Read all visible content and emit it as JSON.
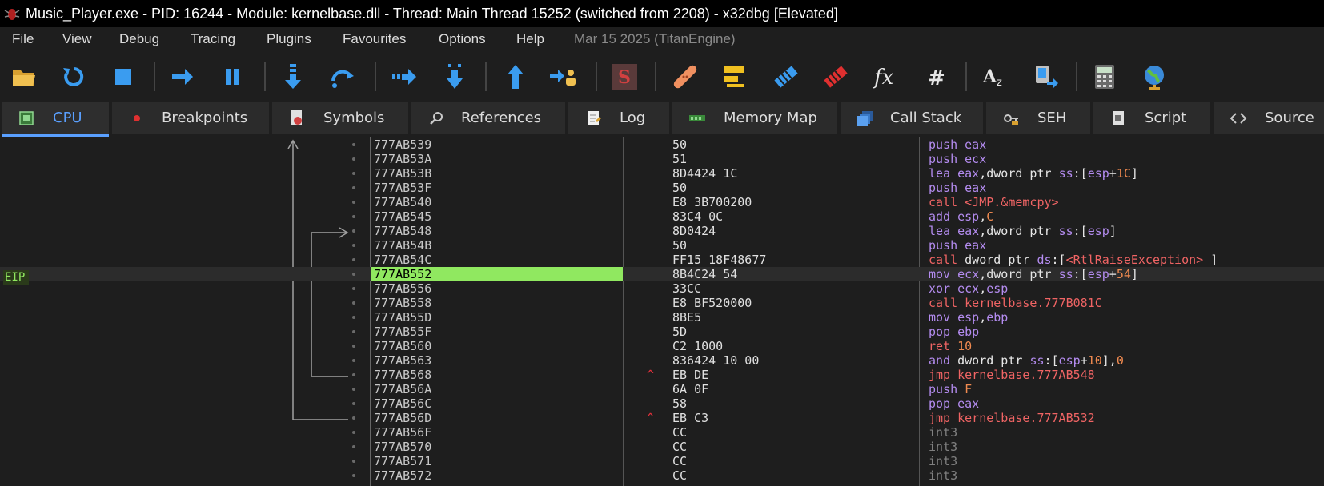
{
  "window": {
    "title": "Music_Player.exe - PID: 16244 - Module: kernelbase.dll - Thread: Main Thread 15252 (switched from 2208) - x32dbg [Elevated]"
  },
  "menu": {
    "items": [
      "File",
      "View",
      "Debug",
      "Tracing",
      "Plugins",
      "Favourites",
      "Options",
      "Help"
    ],
    "date": "Mar 15 2025 (TitanEngine)"
  },
  "toolbar": {
    "buttons": [
      "open-icon",
      "restart-icon",
      "stop-icon",
      "run-icon",
      "pause-icon",
      "step-into-icon",
      "step-over-icon",
      "trace-into-icon",
      "trace-over-icon",
      "execute-till-return-icon",
      "run-to-user-code-icon",
      "scylla-icon",
      "patch-icon",
      "comment-icon",
      "label-icon",
      "bookmark-icon",
      "function-icon",
      "hash-icon",
      "font-icon",
      "device-icon",
      "calculator-icon",
      "globe-icon"
    ]
  },
  "tabs": [
    {
      "label": "CPU",
      "icon": "cpu-icon",
      "active": true
    },
    {
      "label": "Breakpoints",
      "icon": "breakpoint-icon"
    },
    {
      "label": "Symbols",
      "icon": "symbols-icon"
    },
    {
      "label": "References",
      "icon": "references-icon"
    },
    {
      "label": "Log",
      "icon": "log-icon"
    },
    {
      "label": "Memory Map",
      "icon": "memory-map-icon"
    },
    {
      "label": "Call Stack",
      "icon": "call-stack-icon"
    },
    {
      "label": "SEH",
      "icon": "seh-icon"
    },
    {
      "label": "Script",
      "icon": "script-icon"
    },
    {
      "label": "Source",
      "icon": "source-icon"
    }
  ],
  "eip_label": "EIP",
  "disasm": [
    {
      "addr": "777AB539",
      "bytes": "50",
      "marker": "",
      "ins": [
        [
          "push ",
          "purple"
        ],
        [
          "eax",
          "purple"
        ]
      ]
    },
    {
      "addr": "777AB53A",
      "bytes": "51",
      "marker": "",
      "ins": [
        [
          "push ",
          "purple"
        ],
        [
          "ecx",
          "purple"
        ]
      ]
    },
    {
      "addr": "777AB53B",
      "bytes": "8D4424 1C",
      "marker": "",
      "ins": [
        [
          "lea ",
          "purple"
        ],
        [
          "eax",
          "purple"
        ],
        [
          ",dword ptr ",
          "white"
        ],
        [
          "ss",
          "purple"
        ],
        [
          ":[",
          "white"
        ],
        [
          "esp",
          "purple"
        ],
        [
          "+",
          "white"
        ],
        [
          "1C",
          "orange"
        ],
        [
          "]",
          "white"
        ]
      ]
    },
    {
      "addr": "777AB53F",
      "bytes": "50",
      "marker": "",
      "ins": [
        [
          "push ",
          "purple"
        ],
        [
          "eax",
          "purple"
        ]
      ]
    },
    {
      "addr": "777AB540",
      "bytes": "E8 3B700200",
      "marker": "",
      "ins": [
        [
          "call ",
          "red"
        ],
        [
          "<JMP.&memcpy>",
          "red"
        ]
      ]
    },
    {
      "addr": "777AB545",
      "bytes": "83C4 0C",
      "marker": "",
      "ins": [
        [
          "add ",
          "purple"
        ],
        [
          "esp",
          "purple"
        ],
        [
          ",",
          "white"
        ],
        [
          "C",
          "orange"
        ]
      ]
    },
    {
      "addr": "777AB548",
      "bytes": "8D0424",
      "marker": "",
      "ins": [
        [
          "lea ",
          "purple"
        ],
        [
          "eax",
          "purple"
        ],
        [
          ",dword ptr ",
          "white"
        ],
        [
          "ss",
          "purple"
        ],
        [
          ":[",
          "white"
        ],
        [
          "esp",
          "purple"
        ],
        [
          "]",
          "white"
        ]
      ]
    },
    {
      "addr": "777AB54B",
      "bytes": "50",
      "marker": "",
      "ins": [
        [
          "push ",
          "purple"
        ],
        [
          "eax",
          "purple"
        ]
      ]
    },
    {
      "addr": "777AB54C",
      "bytes": "FF15 18F48677",
      "marker": "",
      "ins": [
        [
          "call ",
          "red"
        ],
        [
          "dword ptr ",
          "white"
        ],
        [
          "ds",
          "purple"
        ],
        [
          ":[",
          "white"
        ],
        [
          "<RtlRaiseException>",
          "red"
        ],
        [
          " ]",
          "white"
        ]
      ]
    },
    {
      "addr": "777AB552",
      "bytes": "8B4C24 54",
      "marker": "",
      "eip": true,
      "ins": [
        [
          "mov ",
          "purple"
        ],
        [
          "ecx",
          "purple"
        ],
        [
          ",dword ptr ",
          "white"
        ],
        [
          "ss",
          "purple"
        ],
        [
          ":[",
          "white"
        ],
        [
          "esp",
          "purple"
        ],
        [
          "+",
          "white"
        ],
        [
          "54",
          "orange"
        ],
        [
          "]",
          "white"
        ]
      ]
    },
    {
      "addr": "777AB556",
      "bytes": "33CC",
      "marker": "",
      "ins": [
        [
          "xor ",
          "purple"
        ],
        [
          "ecx",
          "purple"
        ],
        [
          ",",
          "white"
        ],
        [
          "esp",
          "purple"
        ]
      ]
    },
    {
      "addr": "777AB558",
      "bytes": "E8 BF520000",
      "marker": "",
      "ins": [
        [
          "call ",
          "red"
        ],
        [
          "kernelbase.777B081C",
          "red"
        ]
      ]
    },
    {
      "addr": "777AB55D",
      "bytes": "8BE5",
      "marker": "",
      "ins": [
        [
          "mov ",
          "purple"
        ],
        [
          "esp",
          "purple"
        ],
        [
          ",",
          "white"
        ],
        [
          "ebp",
          "purple"
        ]
      ]
    },
    {
      "addr": "777AB55F",
      "bytes": "5D",
      "marker": "",
      "ins": [
        [
          "pop ",
          "purple"
        ],
        [
          "ebp",
          "purple"
        ]
      ]
    },
    {
      "addr": "777AB560",
      "bytes": "C2 1000",
      "marker": "",
      "ins": [
        [
          "ret ",
          "red"
        ],
        [
          "10",
          "orange"
        ]
      ]
    },
    {
      "addr": "777AB563",
      "bytes": "836424 10 00",
      "marker": "",
      "ins": [
        [
          "and ",
          "purple"
        ],
        [
          "dword ptr ",
          "white"
        ],
        [
          "ss",
          "purple"
        ],
        [
          ":[",
          "white"
        ],
        [
          "esp",
          "purple"
        ],
        [
          "+",
          "white"
        ],
        [
          "10",
          "orange"
        ],
        [
          "],",
          "white"
        ],
        [
          "0",
          "orange"
        ]
      ]
    },
    {
      "addr": "777AB568",
      "bytes": "EB DE",
      "marker": "^",
      "ins": [
        [
          "jmp ",
          "red"
        ],
        [
          "kernelbase.777AB548",
          "red"
        ]
      ]
    },
    {
      "addr": "777AB56A",
      "bytes": "6A 0F",
      "marker": "",
      "ins": [
        [
          "push ",
          "purple"
        ],
        [
          "F",
          "orange"
        ]
      ]
    },
    {
      "addr": "777AB56C",
      "bytes": "58",
      "marker": "",
      "ins": [
        [
          "pop ",
          "purple"
        ],
        [
          "eax",
          "purple"
        ]
      ]
    },
    {
      "addr": "777AB56D",
      "bytes": "EB C3",
      "marker": "^",
      "ins": [
        [
          "jmp ",
          "red"
        ],
        [
          "kernelbase.777AB532",
          "red"
        ]
      ]
    },
    {
      "addr": "777AB56F",
      "bytes": "CC",
      "marker": "",
      "ins": [
        [
          "int3",
          "gray"
        ]
      ]
    },
    {
      "addr": "777AB570",
      "bytes": "CC",
      "marker": "",
      "ins": [
        [
          "int3",
          "gray"
        ]
      ]
    },
    {
      "addr": "777AB571",
      "bytes": "CC",
      "marker": "",
      "ins": [
        [
          "int3",
          "gray"
        ]
      ]
    },
    {
      "addr": "777AB572",
      "bytes": "CC",
      "marker": "",
      "ins": [
        [
          "int3",
          "gray"
        ]
      ]
    }
  ]
}
